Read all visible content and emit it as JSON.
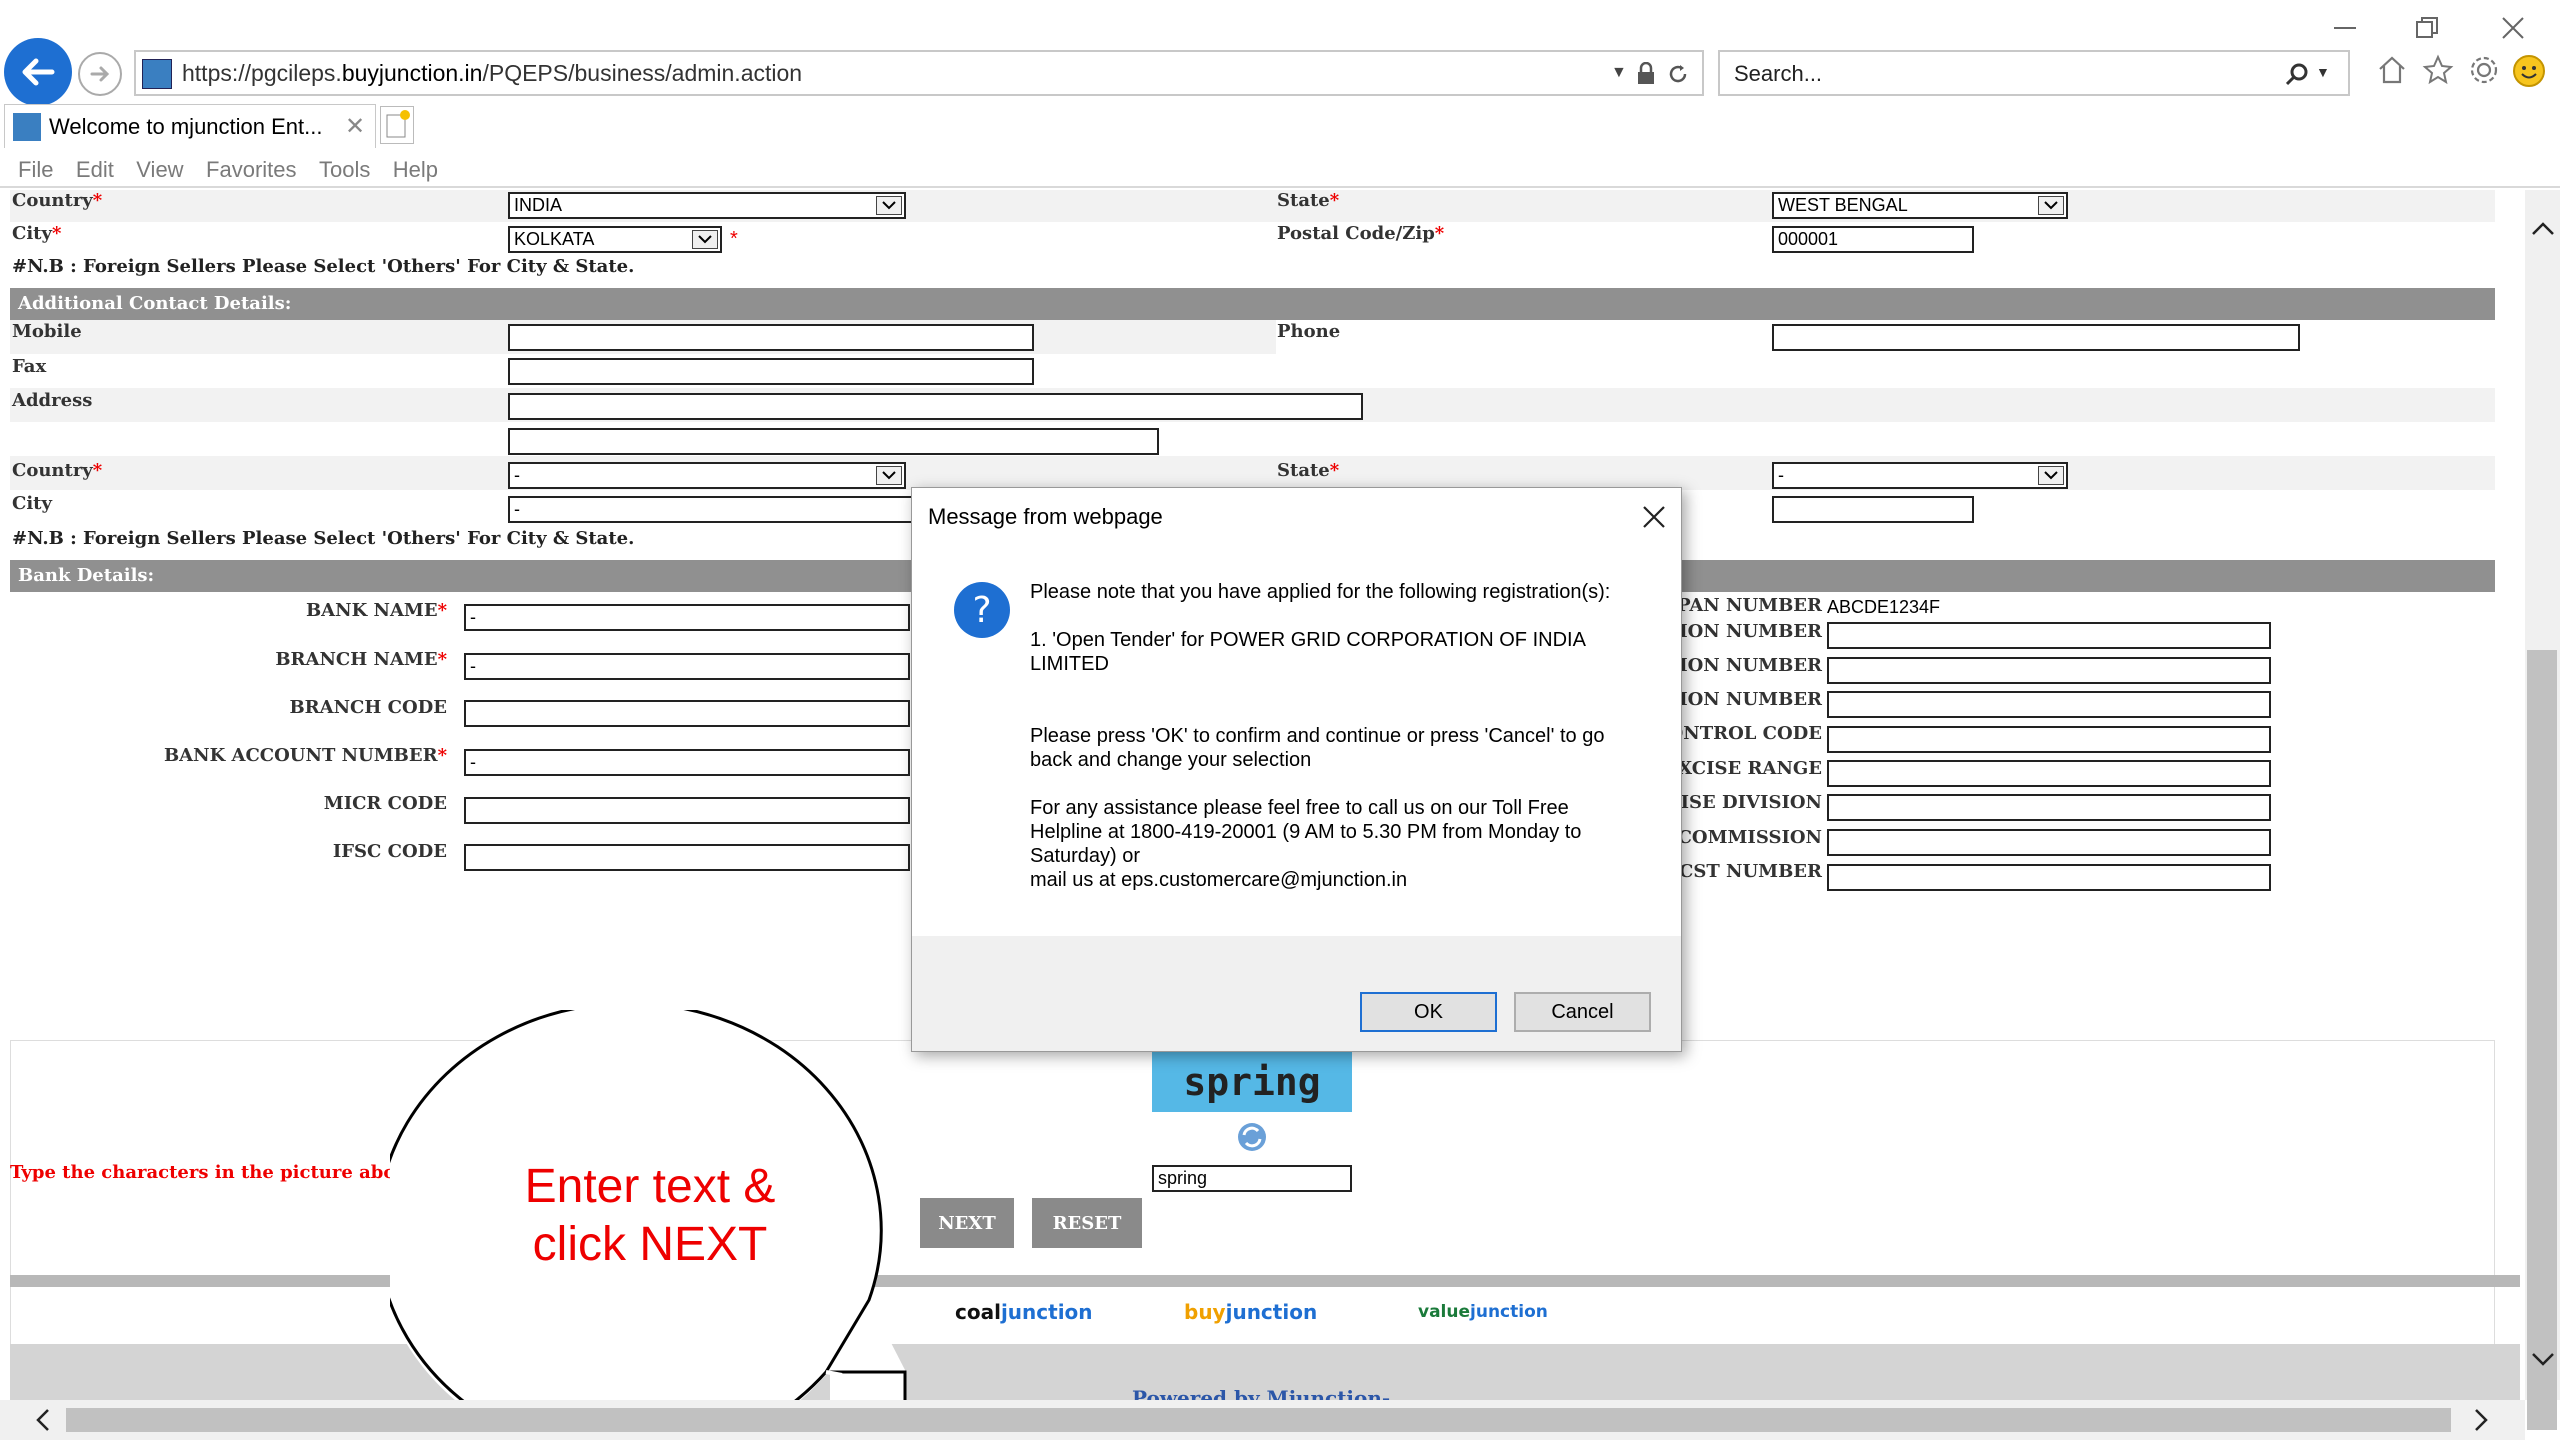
{
  "browser": {
    "url_prefix": "https://pgcileps.",
    "url_domain": "buyjunction.in",
    "url_path": "/PQEPS/business/admin.action",
    "search_placeholder": "Search...",
    "tab_title": "Welcome to mjunction Ent...",
    "menu": [
      "File",
      "Edit",
      "View",
      "Favorites",
      "Tools",
      "Help"
    ]
  },
  "address1": {
    "country_label": "Country",
    "country_value": "INDIA",
    "state_label": "State",
    "state_value": "WEST BENGAL",
    "city_label": "City",
    "city_value": "KOLKATA",
    "postal_label": "Postal Code/Zip",
    "postal_value": "000001",
    "note": "#N.B : Foreign Sellers Please Select 'Others' For City & State."
  },
  "contact": {
    "section_title": "Additional Contact Details:",
    "mobile_label": "Mobile",
    "phone_label": "Phone",
    "fax_label": "Fax",
    "address_label": "Address",
    "country_label": "Country",
    "country_value": "-",
    "state_label": "State",
    "state_value": "-",
    "city_label": "City",
    "city_value": "-",
    "note": "#N.B : Foreign Sellers Please Select 'Others' For City & State."
  },
  "bank": {
    "section_title": "Bank Details:",
    "bank_name_label": "BANK NAME",
    "bank_name_value": "-",
    "branch_name_label": "BRANCH NAME",
    "branch_name_value": "-",
    "branch_code_label": "BRANCH CODE",
    "account_label": "BANK ACCOUNT NUMBER",
    "account_value": "-",
    "micr_label": "MICR CODE",
    "ifsc_label": "IFSC CODE",
    "pan_label": "PAN NUMBER",
    "pan_value": "ABCDE1234F",
    "right_labels": [
      "ATION NUMBER",
      "ATION NUMBER",
      "ATION NUMBER",
      "CONTROL CODE",
      "EXCISE RANGE",
      "CISE DIVISION",
      "E COMMISSION",
      "CST NUMBER"
    ]
  },
  "captcha": {
    "image_text": "spring",
    "instruction": "Type the characters in the picture above and th",
    "input_value": "spring"
  },
  "buttons": {
    "next": "NEXT",
    "reset": "RESET"
  },
  "callout": {
    "text_line1": "Enter text &",
    "text_line2": "click NEXT"
  },
  "footer": {
    "logos": [
      {
        "a": "coal",
        "b": "junction"
      },
      {
        "a": "buy",
        "b": "junction"
      },
      {
        "a": "value",
        "b": "junction"
      }
    ],
    "powered": "Powered by Mjunction-"
  },
  "dialog": {
    "title": "Message from webpage",
    "line1": "Please note that you have applied for the following registration(s):",
    "line2": "1. 'Open Tender' for POWER GRID CORPORATION OF INDIA LIMITED",
    "line3": "Please press 'OK' to confirm and continue or press 'Cancel' to go back and change your selection",
    "line4a": "For any assistance please feel free to call us on our Toll Free Helpline at 1800-419-20001 (9 AM to 5.30 PM from Monday to Saturday) or",
    "line4b": "mail us at eps.customercare@mjunction.in",
    "ok": "OK",
    "cancel": "Cancel"
  },
  "colors": {
    "required_star": "#ee0000",
    "section_bg": "#909090",
    "callout_text": "#ee0000",
    "ie_blue": "#1e6fd2"
  }
}
